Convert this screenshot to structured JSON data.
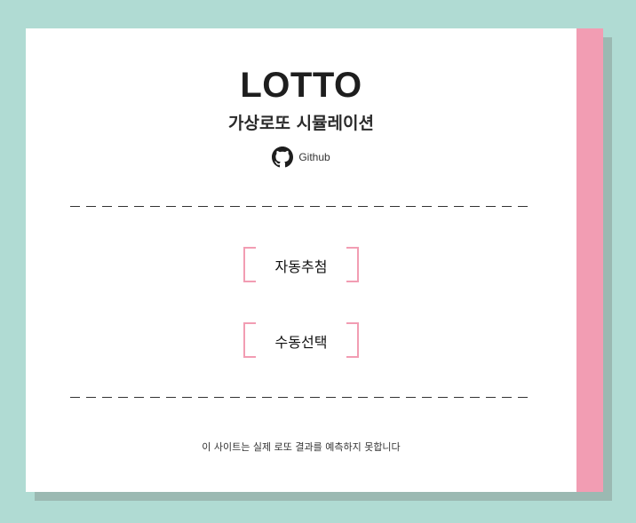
{
  "header": {
    "title": "LOTTO",
    "subtitle": "가상로또 시뮬레이션",
    "github_label": "Github",
    "github_icon": "github-icon"
  },
  "actions": {
    "auto_label": "자동추첨",
    "manual_label": "수동선택"
  },
  "footer": {
    "disclaimer": "이 사이트는 실제 로또 결과를 예측하지 못합니다"
  },
  "colors": {
    "background": "#b0dbd3",
    "card": "#ffffff",
    "accent": "#f29db3",
    "shadow": "#9bb9b2"
  }
}
